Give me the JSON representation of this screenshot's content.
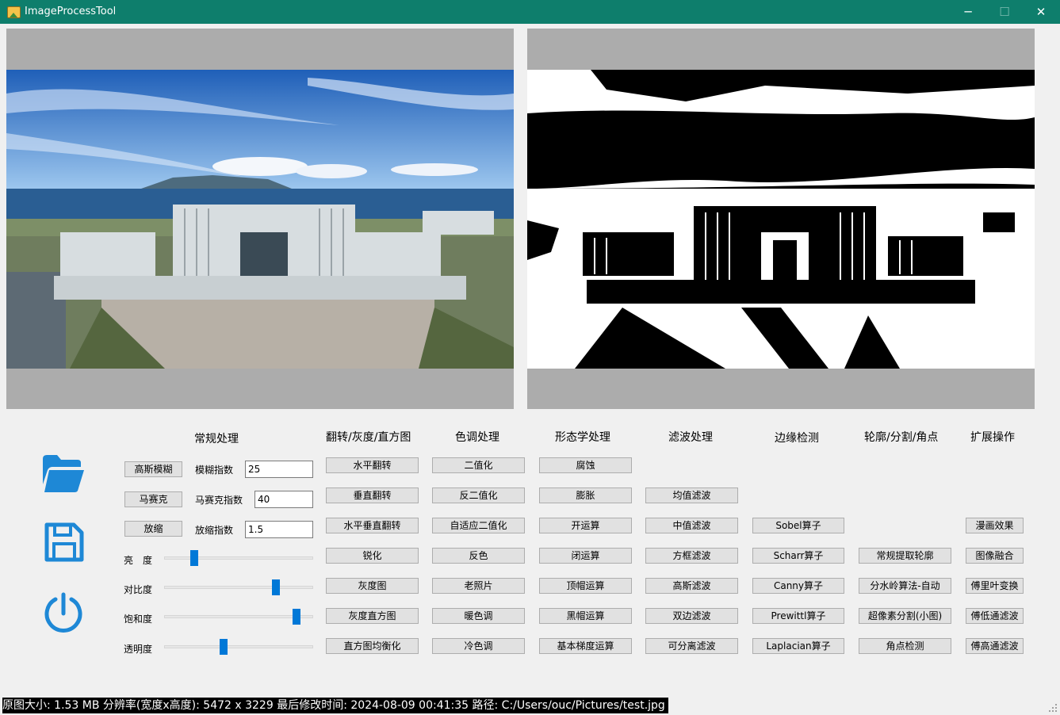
{
  "window": {
    "title": "ImageProcessTool"
  },
  "titlebar_icons": {
    "minimize": "─",
    "maximize": "☐",
    "close": "✕"
  },
  "sections": {
    "regular": "常规处理",
    "flip": "翻转/灰度/直方图",
    "tone": "色调处理",
    "morph": "形态学处理",
    "filter": "滤波处理",
    "edge": "边缘检测",
    "contour": "轮廓/分割/角点",
    "extend": "扩展操作"
  },
  "regular": {
    "gauss_button": "高斯模糊",
    "gauss_label": "模糊指数",
    "gauss_value": "25",
    "mosaic_button": "马赛克",
    "mosaic_label": "马赛克指数",
    "mosaic_value": "40",
    "zoom_button": "放缩",
    "zoom_label": "放缩指数",
    "zoom_value": "1.5"
  },
  "sliders": {
    "brightness_label": "亮　度",
    "brightness": 0.2,
    "contrast_label": "对比度",
    "contrast": 0.75,
    "saturation_label": "饱和度",
    "saturation": 0.89,
    "opacity_label": "透明度",
    "opacity": 0.4
  },
  "flip_buttons": [
    "水平翻转",
    "垂直翻转",
    "水平垂直翻转",
    "锐化",
    "灰度图",
    "灰度直方图",
    "直方图均衡化"
  ],
  "tone_buttons": [
    "二值化",
    "反二值化",
    "自适应二值化",
    "反色",
    "老照片",
    "暖色调",
    "冷色调"
  ],
  "morph_buttons": [
    "腐蚀",
    "膨胀",
    "开运算",
    "闭运算",
    "顶帽运算",
    "黑帽运算",
    "基本梯度运算"
  ],
  "filter_buttons": [
    "均值滤波",
    "中值滤波",
    "方框滤波",
    "高斯滤波",
    "双边滤波",
    "可分离滤波"
  ],
  "edge_buttons": [
    "Sobel算子",
    "Scharr算子",
    "Canny算子",
    "Prewittl算子",
    "Laplacian算子"
  ],
  "contour_buttons": [
    "常规提取轮廓",
    "分水岭算法-自动",
    "超像素分割(小图)",
    "角点检测"
  ],
  "extend_buttons": [
    "漫画效果",
    "图像融合",
    "傅里叶变换",
    "傅低通滤波",
    "傅高通滤波"
  ],
  "left_icons": [
    "folder-open-icon",
    "save-icon",
    "power-icon"
  ],
  "colors": {
    "titlebar": "#0e7e6c",
    "accent": "#1e88d6",
    "slider_thumb": "#0078d7"
  },
  "status": {
    "text": "原图大小: 1.53 MB    分辨率(宽度x高度): 5472 x 3229    最后修改时间: 2024-08-09 00:41:35    路径: C:/Users/ouc/Pictures/test.jpg"
  }
}
